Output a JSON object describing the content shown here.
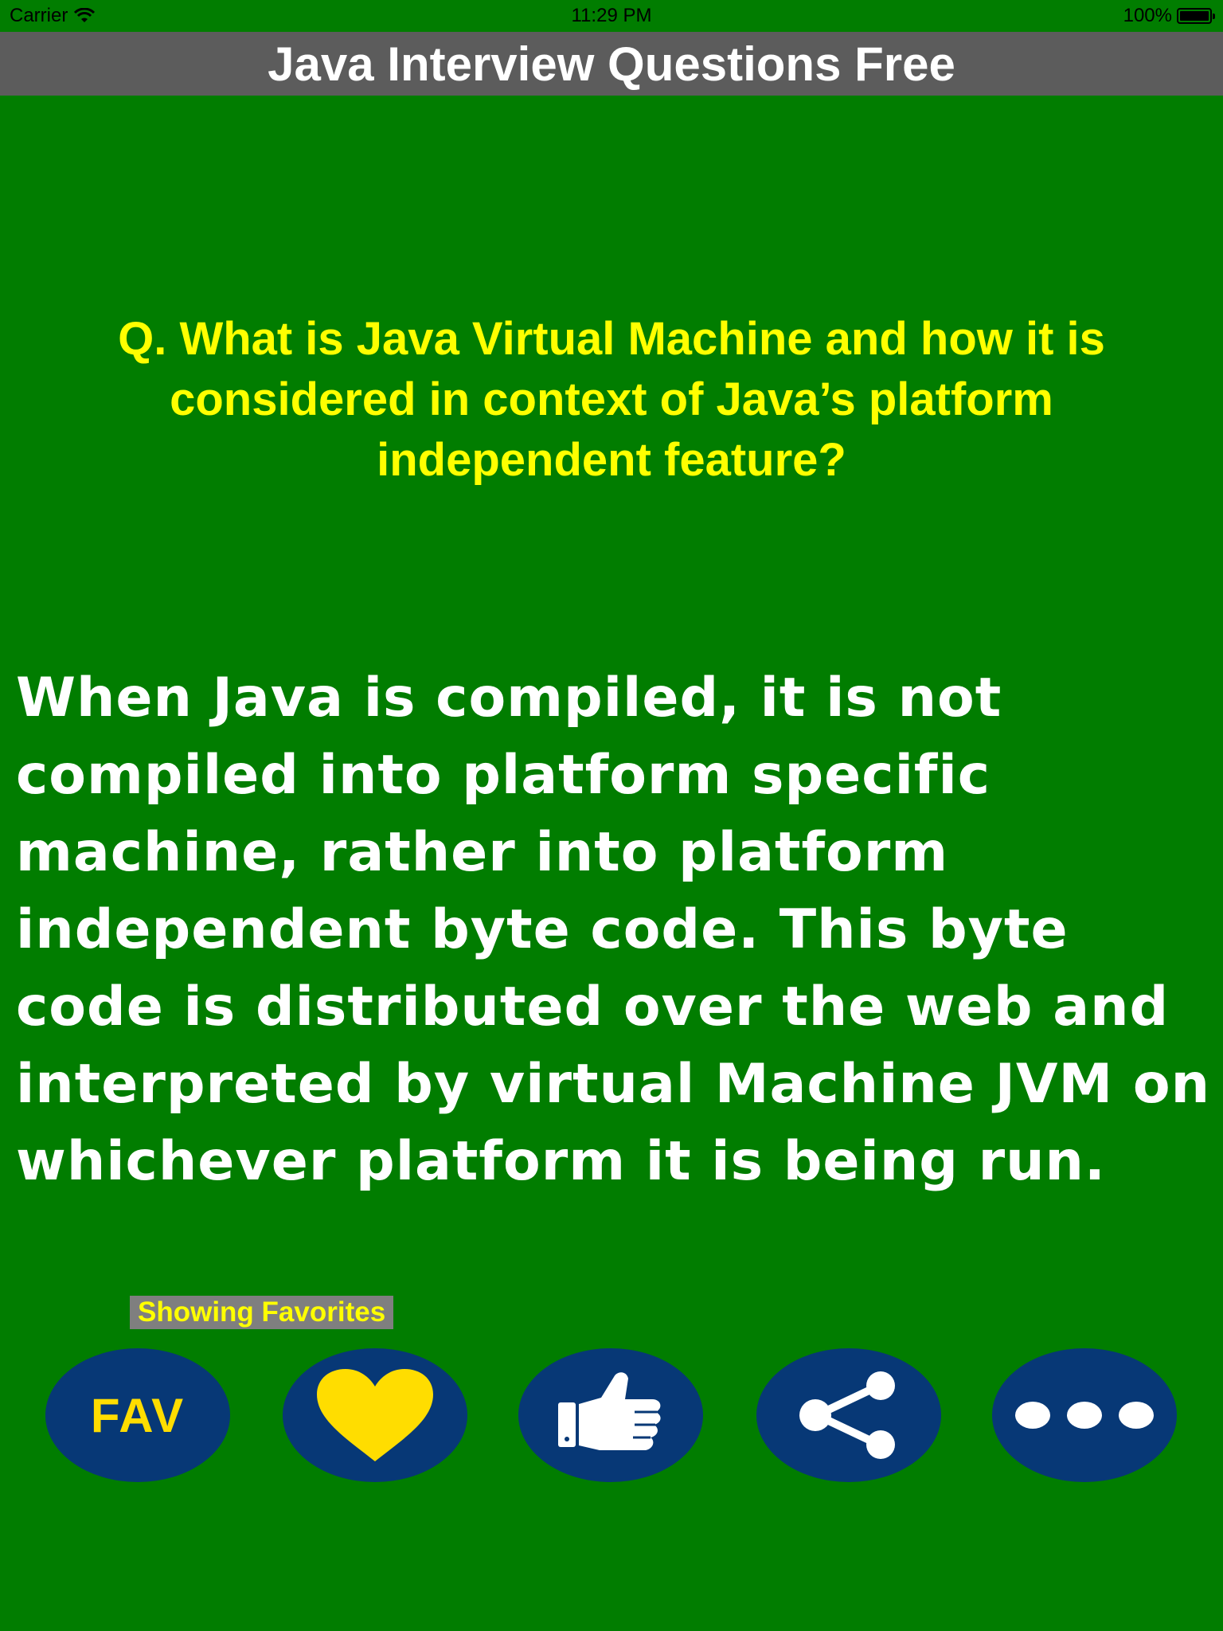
{
  "status_bar": {
    "carrier": "Carrier",
    "time": "11:29 PM",
    "battery": "100%"
  },
  "header": {
    "title": "Java Interview Questions Free"
  },
  "content": {
    "question": "Q. What is Java Virtual Machine and how it is considered in context of Java’s platform independent feature?",
    "answer": "When Java is compiled, it is not compiled into platform specific machine, rather into platform independent byte code. This byte code is distributed over the web and interpreted by virtual Machine JVM on whichever platform it is being run."
  },
  "status_label": "Showing Favorites",
  "toolbar": {
    "fav_label": "FAV",
    "buttons": [
      {
        "icon": "fav-text-icon"
      },
      {
        "icon": "heart-icon"
      },
      {
        "icon": "thumbs-up-icon"
      },
      {
        "icon": "share-icon"
      },
      {
        "icon": "more-icon"
      }
    ]
  },
  "colors": {
    "background": "#017d00",
    "title_bar": "#5c5c5c",
    "question_text": "#ffff00",
    "answer_text": "#ffffff",
    "button_fill": "#073876",
    "icon_yellow": "#ffdd00",
    "label_bg": "#7f7f7f"
  }
}
